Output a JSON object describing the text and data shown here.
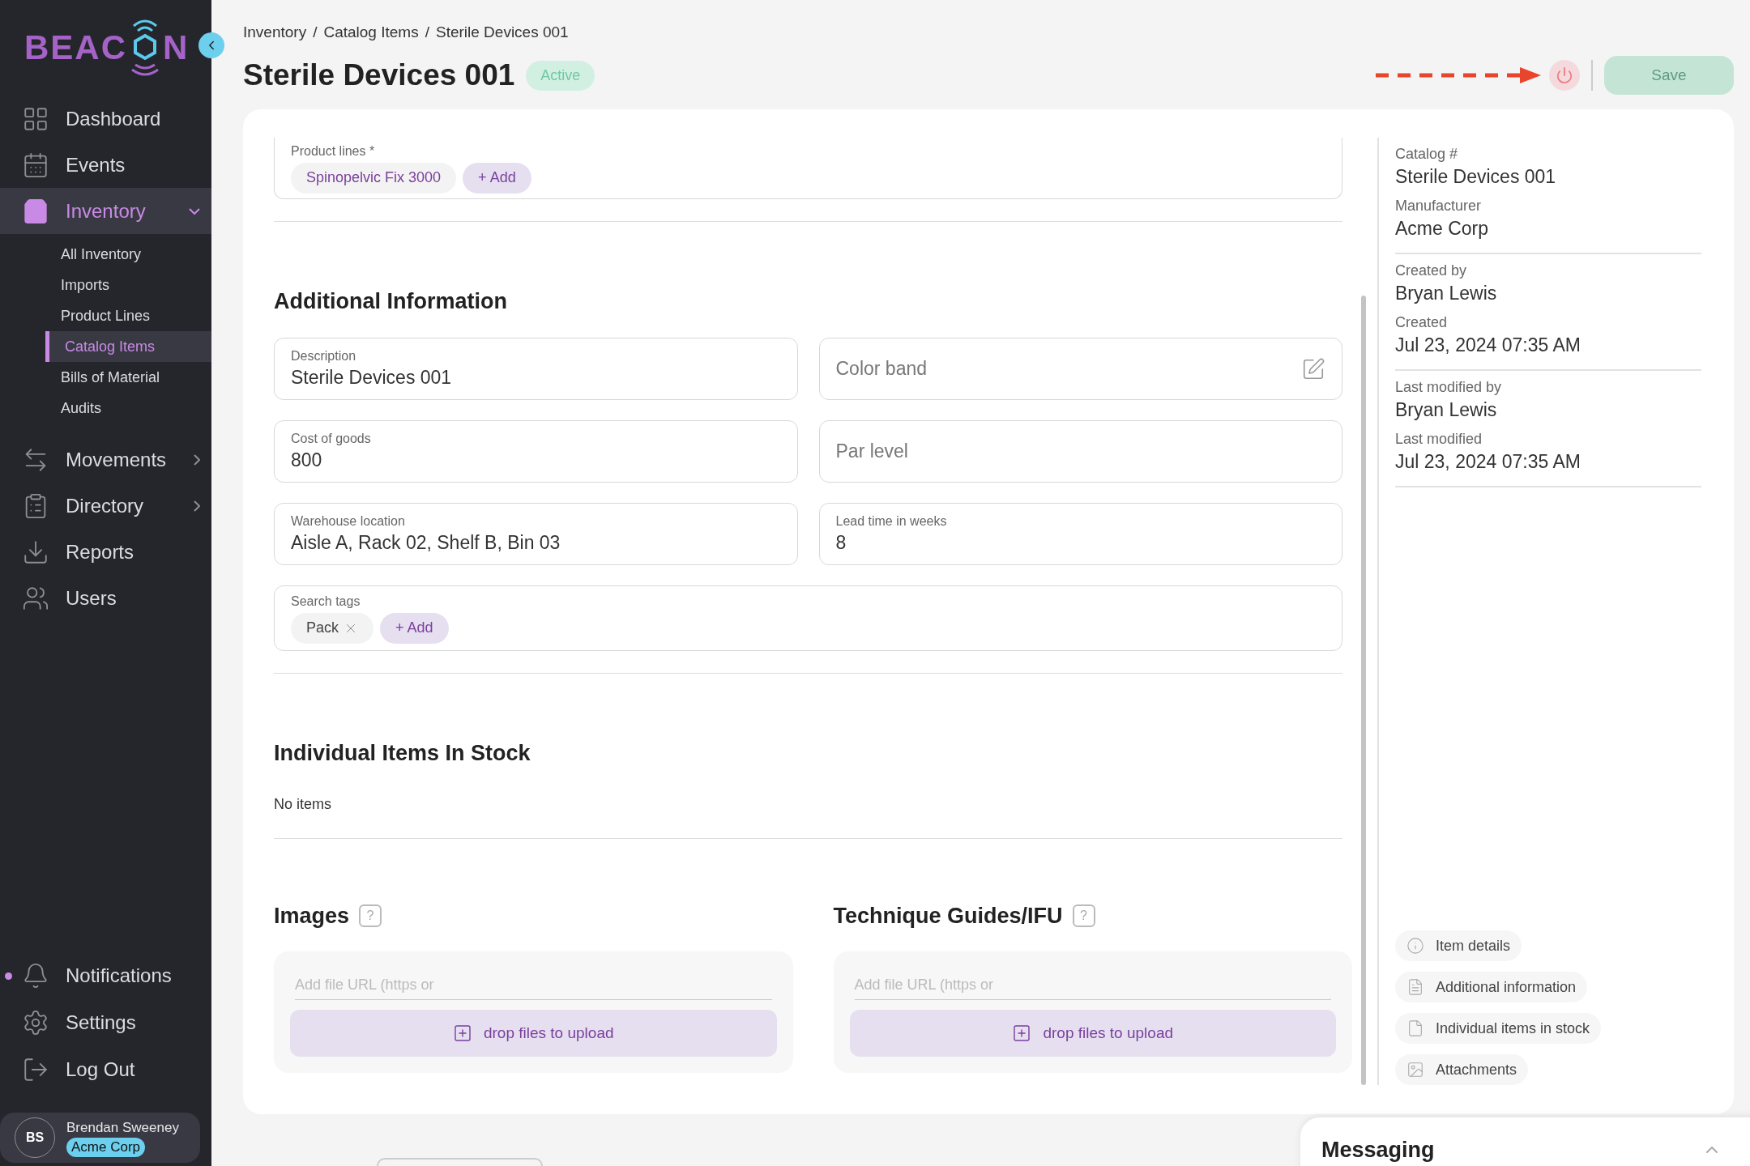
{
  "sidebar": {
    "logo": {
      "text_before": "BEAC",
      "text_after": "N"
    },
    "nav": [
      {
        "kind": "dashboard",
        "label": "Dashboard",
        "selected": false
      },
      {
        "kind": "events",
        "label": "Events",
        "selected": false
      },
      {
        "kind": "inventory",
        "label": "Inventory",
        "selected": true,
        "expanded": true,
        "children": [
          {
            "label": "All Inventory",
            "selected": false
          },
          {
            "label": "Imports",
            "selected": false
          },
          {
            "label": "Product Lines",
            "selected": false
          },
          {
            "label": "Catalog Items",
            "selected": true
          },
          {
            "label": "Bills of Material",
            "selected": false
          },
          {
            "label": "Audits",
            "selected": false
          }
        ]
      },
      {
        "kind": "movements",
        "label": "Movements",
        "selected": false,
        "expanded": false
      },
      {
        "kind": "directory",
        "label": "Directory",
        "selected": false,
        "expanded": false
      },
      {
        "kind": "reports",
        "label": "Reports",
        "selected": false
      },
      {
        "kind": "users",
        "label": "Users",
        "selected": false
      }
    ],
    "bottom": [
      {
        "kind": "notifications",
        "label": "Notifications",
        "unread": true
      },
      {
        "kind": "settings",
        "label": "Settings",
        "unread": false
      },
      {
        "kind": "logout",
        "label": "Log Out",
        "unread": false
      }
    ],
    "user": {
      "initials": "BS",
      "name": "Brendan Sweeney",
      "org": "Acme Corp"
    }
  },
  "breadcrumb": [
    "Inventory",
    "Catalog Items",
    "Sterile Devices 001"
  ],
  "breadcrumb_separator": "/",
  "title": "Sterile Devices 001",
  "status": "Active",
  "actions": {
    "save": "Save",
    "save_disabled": true
  },
  "product_lines": {
    "label": "Product lines *",
    "chips": [
      "Spinopelvic Fix 3000"
    ],
    "add": "+ Add"
  },
  "additional": {
    "heading": "Additional Information",
    "fields": [
      {
        "label": "Description",
        "value": "Sterile Devices 001"
      },
      {
        "placeholder": "Color band",
        "editable_icon": true
      },
      {
        "label": "Cost of goods",
        "value": "800"
      },
      {
        "placeholder": "Par level"
      },
      {
        "label": "Warehouse location",
        "value": "Aisle A, Rack 02, Shelf B, Bin 03"
      },
      {
        "label": "Lead time in weeks",
        "value": "8"
      }
    ],
    "tags": {
      "label": "Search tags",
      "chips": [
        "Pack"
      ],
      "add": "+ Add"
    }
  },
  "items_in_stock": {
    "heading": "Individual Items In Stock",
    "empty": "No items"
  },
  "uploads": [
    {
      "heading": "Images",
      "help": "?",
      "placeholder": "Add file URL (https or",
      "drop": "drop files to upload"
    },
    {
      "heading": "Technique Guides/IFU",
      "help": "?",
      "placeholder": "Add file URL (https or",
      "drop": "drop files to upload"
    }
  ],
  "details": {
    "groups": [
      [
        {
          "label": "Catalog #",
          "value": "Sterile Devices 001"
        },
        {
          "label": "Manufacturer",
          "value": "Acme Corp"
        }
      ],
      [
        {
          "label": "Created by",
          "value": "Bryan Lewis"
        },
        {
          "label": "Created",
          "value": "Jul 23, 2024 07:35 AM"
        }
      ],
      [
        {
          "label": "Last modified by",
          "value": "Bryan Lewis"
        },
        {
          "label": "Last modified",
          "value": "Jul 23, 2024 07:35 AM"
        }
      ]
    ]
  },
  "section_links": [
    {
      "kind": "info",
      "label": "Item details"
    },
    {
      "kind": "list",
      "label": "Additional information"
    },
    {
      "kind": "file",
      "label": "Individual items in stock"
    },
    {
      "kind": "image",
      "label": "Attachments"
    }
  ],
  "messaging": {
    "title": "Messaging",
    "expanded": false
  }
}
